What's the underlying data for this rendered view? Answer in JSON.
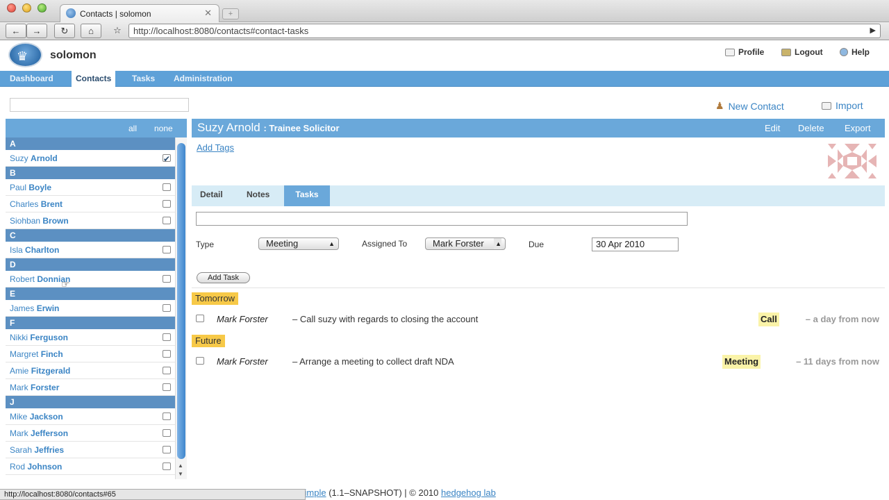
{
  "browser": {
    "tab_title": "Contacts | solomon",
    "tab_close": "✕",
    "new_tab": "+",
    "url": "http://localhost:8080/contacts#contact-tasks",
    "status_url": "http://localhost:8080/contacts#65"
  },
  "app": {
    "name": "solomon",
    "profile_label": "Profile",
    "logout_label": "Logout",
    "help_label": "Help"
  },
  "nav": {
    "items": [
      "Dashboard",
      "Contacts",
      "Tasks",
      "Administration"
    ],
    "active": "Contacts"
  },
  "actions": {
    "new_contact": "New Contact",
    "import": "Import"
  },
  "list": {
    "all_label": "all",
    "none_label": "none",
    "groups": [
      {
        "letter": "A",
        "contacts": [
          {
            "first": "Suzy",
            "last": "Arnold",
            "checked": true
          }
        ]
      },
      {
        "letter": "B",
        "contacts": [
          {
            "first": "Paul",
            "last": "Boyle"
          },
          {
            "first": "Charles",
            "last": "Brent"
          },
          {
            "first": "Siohban",
            "last": "Brown"
          }
        ]
      },
      {
        "letter": "C",
        "contacts": [
          {
            "first": "Isla",
            "last": "Charlton"
          }
        ]
      },
      {
        "letter": "D",
        "contacts": [
          {
            "first": "Robert",
            "last": "Donnian"
          }
        ]
      },
      {
        "letter": "E",
        "contacts": [
          {
            "first": "James",
            "last": "Erwin"
          }
        ]
      },
      {
        "letter": "F",
        "contacts": [
          {
            "first": "Nikki",
            "last": "Ferguson"
          },
          {
            "first": "Margret",
            "last": "Finch"
          },
          {
            "first": "Amie",
            "last": "Fitzgerald"
          },
          {
            "first": "Mark",
            "last": "Forster"
          }
        ]
      },
      {
        "letter": "J",
        "contacts": [
          {
            "first": "Mike",
            "last": "Jackson"
          },
          {
            "first": "Mark",
            "last": "Jefferson"
          },
          {
            "first": "Sarah",
            "last": "Jeffries"
          },
          {
            "first": "Rod",
            "last": "Johnson"
          }
        ]
      }
    ]
  },
  "detail": {
    "name": "Suzy Arnold",
    "role": ": Trainee Solicitor",
    "edit": "Edit",
    "delete": "Delete",
    "export": "Export",
    "add_tags": "Add Tags",
    "tabs": [
      "Detail",
      "Notes",
      "Tasks"
    ],
    "active_tab": "Tasks"
  },
  "task_form": {
    "type_label": "Type",
    "type_value": "Meeting",
    "assigned_label": "Assigned To",
    "assigned_value": "Mark Forster",
    "due_label": "Due",
    "due_value": "30 Apr 2010",
    "add_button": "Add Task"
  },
  "tasks": [
    {
      "group": "Tomorrow",
      "who": "Mark Forster",
      "text": "– Call suzy with regards to closing the account",
      "type": "Call",
      "when": "– a day from now"
    },
    {
      "group": "Future",
      "who": "Mark Forster",
      "text": "– Arrange a meeting to collect draft NDA",
      "type": "Meeting",
      "when": "– 11 days from now"
    }
  ],
  "footer": {
    "link1": "simple",
    "version": "(1.1–SNAPSHOT)  |  © 2010",
    "link2": "hedgehog lab"
  },
  "colors": {
    "accent": "#6aa8da",
    "nav": "#5ea1d8",
    "link": "#3a84c4",
    "group_badge": "#f7c948",
    "type_badge": "#faf3a8"
  }
}
